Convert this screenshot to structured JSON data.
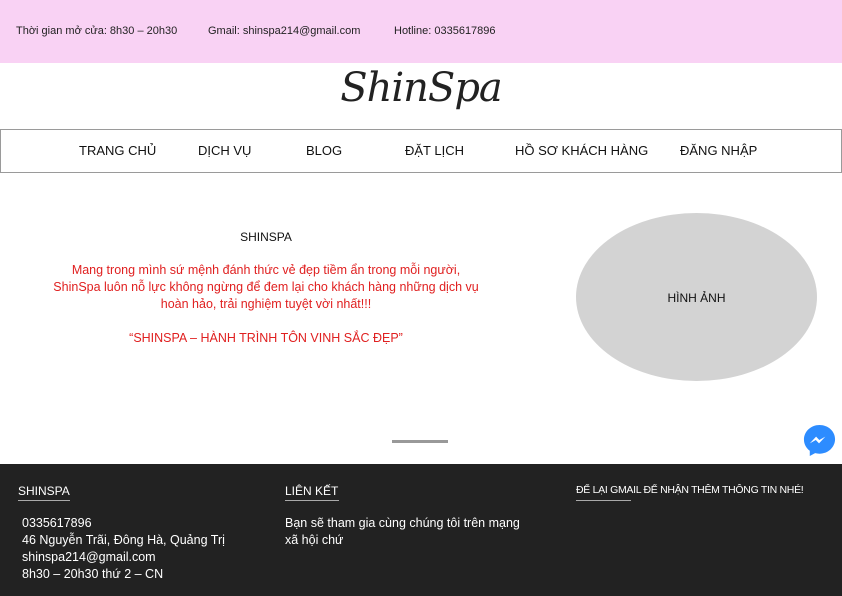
{
  "topbar": {
    "hours": "Thời gian mở cửa: 8h30 – 20h30",
    "email": "Gmail: shinspa214@gmail.com",
    "hotline": "Hotline: 0335617896"
  },
  "logo": "ShinSpa",
  "nav": {
    "items": [
      "TRANG CHỦ",
      "DỊCH VỤ",
      "BLOG",
      "ĐẶT LỊCH",
      "HỒ SƠ KHÁCH HÀNG",
      "ĐĂNG NHẬP"
    ]
  },
  "hero": {
    "title": "SHINSPA",
    "intro_lines": [
      "Mang trong mình sứ mệnh đánh thức vẻ đẹp tiềm ẩn trong mỗi người,",
      "ShinSpa luôn nỗ lực không ngừng để đem lại cho khách hàng những dịch vụ",
      "hoàn hảo, trải nghiệm tuyệt vời nhất!!!"
    ],
    "slogan": "“SHINSPA – HÀNH TRÌNH TÔN VINH SẮC ĐẸP”",
    "image_label": "HÌNH ẢNH"
  },
  "icons": {
    "messenger": "messenger-icon"
  },
  "colors": {
    "topbar": "#f9d2f4",
    "accent_red": "#e02020",
    "footer": "#222222",
    "messenger": "#2d8cff"
  },
  "footer": {
    "col1": {
      "heading": "SHINSPA",
      "lines": [
        "0335617896",
        "46 Nguyễn Trãi, Đông Hà, Quảng Trị",
        "shinspa214@gmail.com",
        "8h30 – 20h30 thứ 2 – CN"
      ]
    },
    "col2": {
      "heading": "LIÊN KẾT",
      "lines": [
        "Bạn sẽ tham gia cùng chúng tôi trên mạng",
        "xã hội chứ"
      ]
    },
    "col3": {
      "heading": "ĐỂ LẠI GMAIL ĐỂ NHẬN THÊM THÔNG TIN NHÉ!"
    }
  }
}
